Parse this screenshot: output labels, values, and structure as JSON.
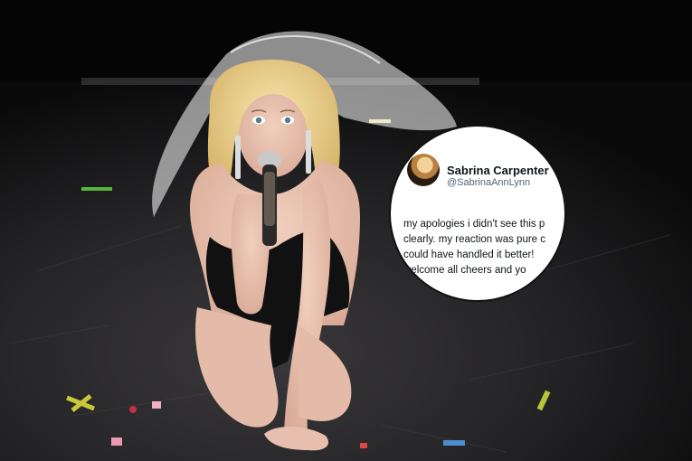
{
  "tweet": {
    "display_name": "Sabrina Carpenter",
    "handle": "@SabrinaAnnLynn",
    "verified": true,
    "text_lines": [
      "my apologies i didn't see this p",
      "clearly. my reaction was pure c",
      "could have handled it better!",
      "welcome all cheers and yo"
    ]
  },
  "colors": {
    "stage_floor": "#2b2a2c",
    "verified_badge": "#1d9bf0",
    "dress": "#111111"
  }
}
